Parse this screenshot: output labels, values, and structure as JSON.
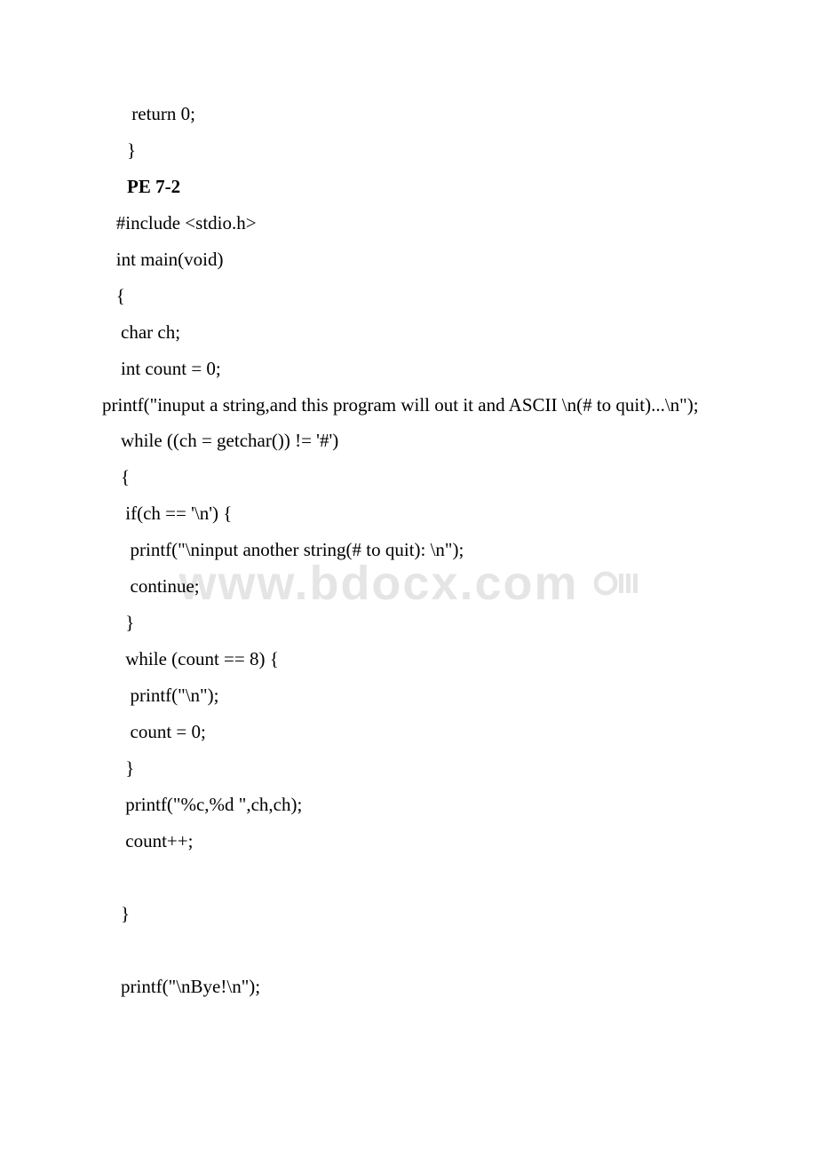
{
  "lines": [
    {
      "cls": "indent1",
      "text": " return 0;"
    },
    {
      "cls": "indent1",
      "text": "}"
    },
    {
      "cls": "indent1 bold",
      "text": "PE 7-2"
    },
    {
      "cls": "",
      "text": "   #include <stdio.h>"
    },
    {
      "cls": "",
      "text": "   int main(void)"
    },
    {
      "cls": "",
      "text": "   {"
    },
    {
      "cls": "",
      "text": "    char ch;"
    },
    {
      "cls": "",
      "text": "    int count = 0;"
    },
    {
      "cls": "wrap-line",
      "text": "    printf(\"inuput a string,and this program will out it and ASCII \\n(# to quit)...\\n\");"
    },
    {
      "cls": "",
      "text": "    while ((ch = getchar()) != '#')"
    },
    {
      "cls": "",
      "text": "    {"
    },
    {
      "cls": "",
      "text": "     if(ch == '\\n') {"
    },
    {
      "cls": "",
      "text": "      printf(\"\\ninput another string(# to quit): \\n\");"
    },
    {
      "cls": "",
      "text": "      continue;"
    },
    {
      "cls": "",
      "text": "     }"
    },
    {
      "cls": "",
      "text": "     while (count == 8) {"
    },
    {
      "cls": "",
      "text": "      printf(\"\\n\");"
    },
    {
      "cls": "",
      "text": "      count = 0;"
    },
    {
      "cls": "",
      "text": "     }"
    },
    {
      "cls": "",
      "text": "     printf(\"%c,%d \",ch,ch);"
    },
    {
      "cls": "",
      "text": "     count++;"
    },
    {
      "cls": "",
      "text": "   "
    },
    {
      "cls": "",
      "text": "    }"
    },
    {
      "cls": "",
      "text": "   "
    },
    {
      "cls": "",
      "text": "    printf(\"\\nBye!\\n\");"
    }
  ],
  "watermark": "www.bdocx.com"
}
